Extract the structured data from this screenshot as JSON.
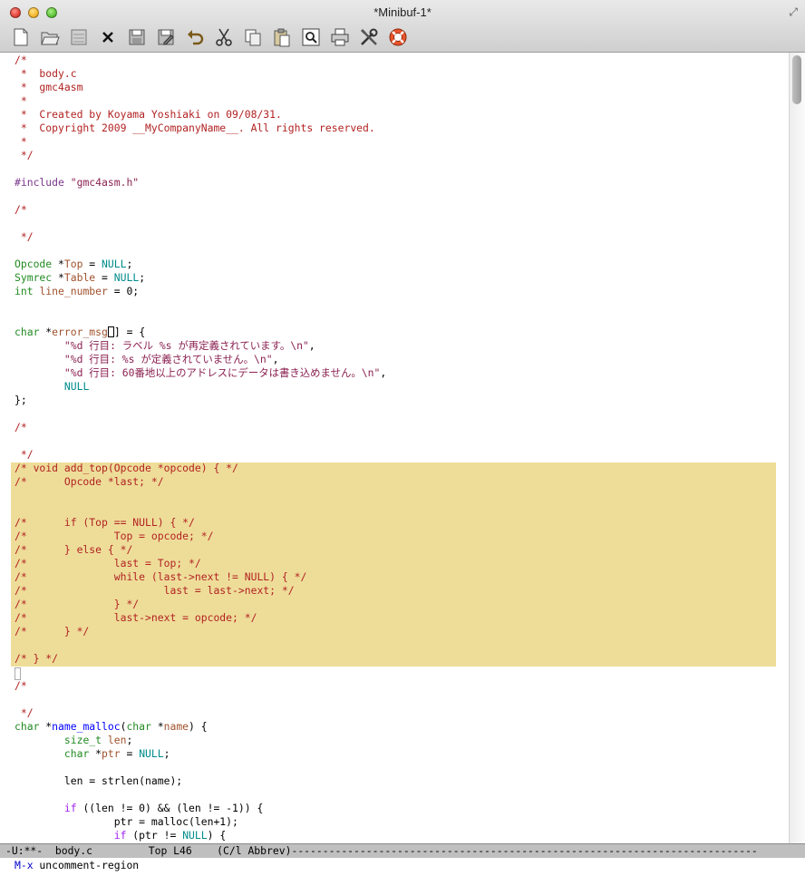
{
  "window": {
    "title": "*Minibuf-1*"
  },
  "toolbar": {
    "icons": [
      "new-file-icon",
      "open-folder-icon",
      "open-directory-icon",
      "close-buffer-icon",
      "save-icon",
      "save-as-icon",
      "undo-icon",
      "cut-icon",
      "copy-icon",
      "paste-icon",
      "search-icon",
      "print-icon",
      "preferences-icon",
      "help-icon"
    ]
  },
  "code_lines": [
    [
      {
        "t": "/*",
        "c": "cm"
      }
    ],
    [
      {
        "t": " *  body.c",
        "c": "cm"
      }
    ],
    [
      {
        "t": " *  gmc4asm",
        "c": "cm"
      }
    ],
    [
      {
        "t": " *",
        "c": "cm"
      }
    ],
    [
      {
        "t": " *  Created by Koyama Yoshiaki on 09/08/31.",
        "c": "cm"
      }
    ],
    [
      {
        "t": " *  Copyright 2009 __MyCompanyName__. All rights reserved.",
        "c": "cm"
      }
    ],
    [
      {
        "t": " *",
        "c": "cm"
      }
    ],
    [
      {
        "t": " */",
        "c": "cm"
      }
    ],
    [],
    [
      {
        "t": "#include ",
        "c": "pp"
      },
      {
        "t": "\"gmc4asm.h\"",
        "c": "st"
      }
    ],
    [],
    [
      {
        "t": "/*",
        "c": "cm"
      }
    ],
    [],
    [
      {
        "t": " */",
        "c": "cm"
      }
    ],
    [],
    [
      {
        "t": "Opcode",
        "c": "ty"
      },
      {
        "t": " *",
        "c": "pl"
      },
      {
        "t": "Top",
        "c": "vr"
      },
      {
        "t": " = ",
        "c": "pl"
      },
      {
        "t": "NULL",
        "c": "cn"
      },
      {
        "t": ";",
        "c": "pl"
      }
    ],
    [
      {
        "t": "Symrec",
        "c": "ty"
      },
      {
        "t": " *",
        "c": "pl"
      },
      {
        "t": "Table",
        "c": "vr"
      },
      {
        "t": " = ",
        "c": "pl"
      },
      {
        "t": "NULL",
        "c": "cn"
      },
      {
        "t": ";",
        "c": "pl"
      }
    ],
    [
      {
        "t": "int",
        "c": "ty"
      },
      {
        "t": " ",
        "c": "pl"
      },
      {
        "t": "line_number",
        "c": "vr"
      },
      {
        "t": " = 0;",
        "c": "pl"
      }
    ],
    [],
    [],
    [
      {
        "t": "char",
        "c": "ty"
      },
      {
        "t": " *",
        "c": "pl"
      },
      {
        "t": "error_msg",
        "c": "vr"
      },
      {
        "t": "CURSOR",
        "c": "cur"
      },
      {
        "t": "] = {",
        "c": "pl"
      }
    ],
    [
      {
        "t": "        \"%d 行目: ラベル %s が再定義されています。\\n\"",
        "c": "st"
      },
      {
        "t": ",",
        "c": "pl"
      }
    ],
    [
      {
        "t": "        \"%d 行目: %s が定義されていません。\\n\"",
        "c": "st"
      },
      {
        "t": ",",
        "c": "pl"
      }
    ],
    [
      {
        "t": "        \"%d 行目: 60番地以上のアドレスにデータは書き込めません。\\n\"",
        "c": "st"
      },
      {
        "t": ",",
        "c": "pl"
      }
    ],
    [
      {
        "t": "        ",
        "c": "pl"
      },
      {
        "t": "NULL",
        "c": "cn"
      }
    ],
    [
      {
        "t": "};",
        "c": "pl"
      }
    ],
    [],
    [
      {
        "t": "/*",
        "c": "cm"
      }
    ],
    [],
    [
      {
        "t": " */",
        "c": "cm"
      }
    ],
    [
      {
        "t": "/* void add_top(Opcode *opcode) { */",
        "c": "cm"
      }
    ],
    [
      {
        "t": "/*      Opcode *last; */",
        "c": "cm"
      }
    ],
    [],
    [],
    [
      {
        "t": "/*      if (Top == NULL) { */",
        "c": "cm"
      }
    ],
    [
      {
        "t": "/*              Top = opcode; */",
        "c": "cm"
      }
    ],
    [
      {
        "t": "/*      } else { */",
        "c": "cm"
      }
    ],
    [
      {
        "t": "/*              last = Top; */",
        "c": "cm"
      }
    ],
    [
      {
        "t": "/*              while (last->next != NULL) { */",
        "c": "cm"
      }
    ],
    [
      {
        "t": "/*                      last = last->next; */",
        "c": "cm"
      }
    ],
    [
      {
        "t": "/*              } */",
        "c": "cm"
      }
    ],
    [
      {
        "t": "/*              last->next = opcode; */",
        "c": "cm"
      }
    ],
    [
      {
        "t": "/*      } */",
        "c": "cm"
      }
    ],
    [],
    [
      {
        "t": "/* } */",
        "c": "cm"
      }
    ],
    [],
    [
      {
        "t": "/*",
        "c": "cm"
      }
    ],
    [],
    [
      {
        "t": " */",
        "c": "cm"
      }
    ],
    [
      {
        "t": "char",
        "c": "ty"
      },
      {
        "t": " *",
        "c": "pl"
      },
      {
        "t": "name_malloc",
        "c": "fn"
      },
      {
        "t": "(",
        "c": "pl"
      },
      {
        "t": "char",
        "c": "ty"
      },
      {
        "t": " *",
        "c": "pl"
      },
      {
        "t": "name",
        "c": "vr"
      },
      {
        "t": ") {",
        "c": "pl"
      }
    ],
    [
      {
        "t": "        ",
        "c": "pl"
      },
      {
        "t": "size_t",
        "c": "ty"
      },
      {
        "t": " ",
        "c": "pl"
      },
      {
        "t": "len",
        "c": "vr"
      },
      {
        "t": ";",
        "c": "pl"
      }
    ],
    [
      {
        "t": "        ",
        "c": "pl"
      },
      {
        "t": "char",
        "c": "ty"
      },
      {
        "t": " *",
        "c": "pl"
      },
      {
        "t": "ptr",
        "c": "vr"
      },
      {
        "t": " = ",
        "c": "pl"
      },
      {
        "t": "NULL",
        "c": "cn"
      },
      {
        "t": ";",
        "c": "pl"
      }
    ],
    [],
    [
      {
        "t": "        len = strlen(name);",
        "c": "pl"
      }
    ],
    [],
    [
      {
        "t": "        ",
        "c": "pl"
      },
      {
        "t": "if",
        "c": "kw"
      },
      {
        "t": " ((len != 0) && (len != -1)) {",
        "c": "pl"
      }
    ],
    [
      {
        "t": "                ptr = malloc(len+1);",
        "c": "pl"
      }
    ],
    [
      {
        "t": "                ",
        "c": "pl"
      },
      {
        "t": "if",
        "c": "kw"
      },
      {
        "t": " (ptr != ",
        "c": "pl"
      },
      {
        "t": "NULL",
        "c": "cn"
      },
      {
        "t": ") {",
        "c": "pl"
      }
    ]
  ],
  "modeline": {
    "text": "-U:**-  body.c         Top L46    (C/l Abbrev)---------------------------------------------------------------------------"
  },
  "minibuffer": {
    "prompt": "M-x",
    "command": " uncomment-region"
  }
}
